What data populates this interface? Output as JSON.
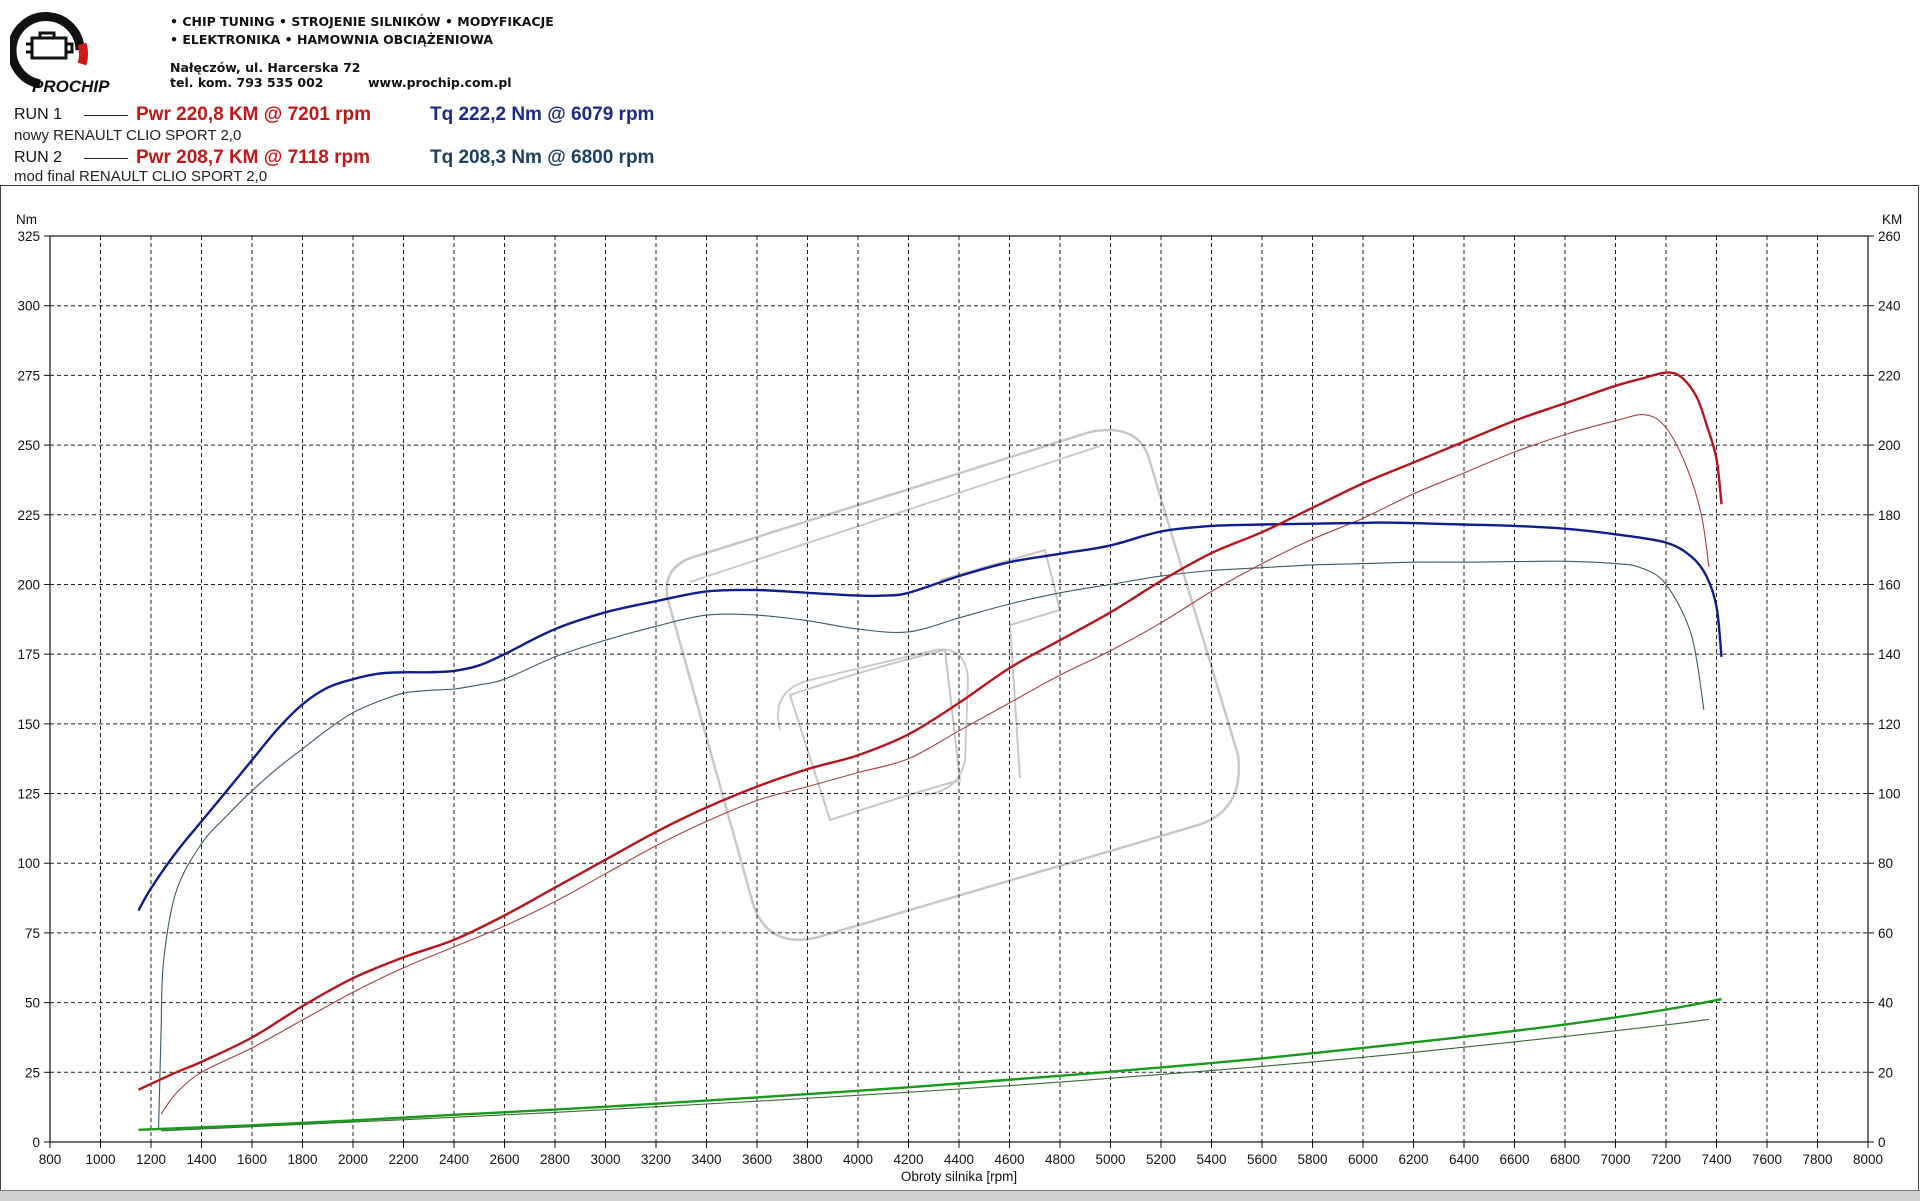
{
  "header": {
    "logo_text": "PROCHIP",
    "services_line1": "• CHIP TUNING • STROJENIE SILNIKÓW • MODYFIKACJE",
    "services_line2": "• ELEKTRONIKA • HAMOWNIA OBCIĄŻENIOWA",
    "address": "Nałęczów, ul. Harcerska 72",
    "phone": "tel. kom. 793 535 002",
    "website": "www.prochip.com.pl"
  },
  "runs": [
    {
      "label": "RUN 1",
      "power": "Pwr  220,8 KM @ 7201 rpm",
      "torque": "Tq 222,2 Nm @ 6079 rpm",
      "description": "nowy RENAULT CLIO SPORT 2,0"
    },
    {
      "label": "RUN 2",
      "power": "Pwr  208,7 KM @ 7118 rpm",
      "torque": "Tq 208,3 Nm @ 6800 rpm",
      "description": "mod final RENAULT CLIO SPORT 2,0"
    }
  ],
  "colors": {
    "power": "#b5161c",
    "power_run2": "#a84040",
    "torque": "#0e1e8c",
    "torque_run2": "#3a5a6a",
    "loss": "#1a9a1a",
    "loss_run2": "#3a6a3a",
    "grid": "#222222"
  },
  "chart_data": {
    "type": "line",
    "xlabel": "Obroty silnika [rpm]",
    "ylabel_left": "Nm",
    "ylabel_right": "KM",
    "xlim": [
      800,
      8000
    ],
    "ylim_left": [
      0,
      325
    ],
    "ylim_right": [
      0,
      260
    ],
    "x_ticks": [
      800,
      1000,
      1200,
      1400,
      1600,
      1800,
      2000,
      2200,
      2400,
      2600,
      2800,
      3000,
      3200,
      3400,
      3600,
      3800,
      4000,
      4200,
      4400,
      4600,
      4800,
      5000,
      5200,
      5400,
      5600,
      5800,
      6000,
      6200,
      6400,
      6600,
      6800,
      7000,
      7200,
      7400,
      7600,
      7800,
      8000
    ],
    "y_ticks_left": [
      0,
      25,
      50,
      75,
      100,
      125,
      150,
      175,
      200,
      225,
      250,
      275,
      300,
      325
    ],
    "y_ticks_right": [
      0,
      20,
      40,
      60,
      80,
      100,
      120,
      140,
      160,
      180,
      200,
      220,
      240,
      260
    ],
    "grid": true,
    "series": [
      {
        "name": "RUN 1 Tq",
        "axis": "left",
        "role": "torque",
        "run": 1,
        "x": [
          1150,
          1200,
          1300,
          1400,
          1500,
          1600,
          1700,
          1800,
          1900,
          2000,
          2100,
          2200,
          2300,
          2400,
          2500,
          2600,
          2800,
          3000,
          3200,
          3400,
          3600,
          3800,
          4000,
          4100,
          4200,
          4400,
          4600,
          4800,
          5000,
          5200,
          5400,
          5600,
          5800,
          6000,
          6079,
          6200,
          6400,
          6600,
          6800,
          7000,
          7200,
          7300,
          7360,
          7400,
          7420
        ],
        "y": [
          83,
          91,
          104,
          115,
          126,
          137,
          148,
          157,
          163,
          166,
          168,
          168.5,
          168.5,
          169,
          171,
          175,
          184,
          190,
          194,
          197.5,
          198,
          197,
          196,
          196,
          197,
          203,
          208,
          211,
          214,
          219,
          221,
          221.5,
          221.8,
          222.1,
          222.2,
          222,
          221.5,
          221,
          220,
          218,
          215,
          210,
          203,
          192,
          174
        ]
      },
      {
        "name": "RUN 2 Tq",
        "axis": "left",
        "role": "torque",
        "run": 2,
        "x": [
          1230,
          1240,
          1250,
          1300,
          1400,
          1500,
          1600,
          1700,
          1800,
          1900,
          2000,
          2100,
          2200,
          2300,
          2400,
          2500,
          2600,
          2800,
          3000,
          3200,
          3400,
          3600,
          3800,
          4000,
          4200,
          4400,
          4600,
          4800,
          5000,
          5200,
          5400,
          5600,
          5800,
          6000,
          6200,
          6400,
          6600,
          6800,
          7000,
          7100,
          7200,
          7300,
          7350
        ],
        "y": [
          5,
          40,
          65,
          90,
          107,
          117,
          126,
          134,
          141,
          148,
          154,
          158,
          161,
          162,
          162.5,
          164,
          166,
          174,
          180,
          185,
          189,
          189,
          187,
          184,
          183,
          188,
          193,
          197,
          200,
          203,
          205,
          206,
          207,
          207.5,
          208,
          208,
          208.2,
          208.3,
          207.5,
          206,
          200,
          182,
          155
        ]
      },
      {
        "name": "RUN 1 Pwr",
        "axis": "right",
        "role": "power",
        "run": 1,
        "x": [
          1150,
          1300,
          1400,
          1600,
          1800,
          2000,
          2200,
          2400,
          2600,
          2800,
          3000,
          3200,
          3400,
          3600,
          3800,
          4000,
          4200,
          4400,
          4600,
          4800,
          5000,
          5200,
          5400,
          5600,
          5800,
          6000,
          6200,
          6400,
          6600,
          6800,
          7000,
          7100,
          7201,
          7260,
          7320,
          7360,
          7400,
          7420
        ],
        "y": [
          15,
          20,
          23,
          30,
          39,
          47,
          53,
          58,
          65,
          73,
          81,
          89,
          96,
          102,
          107,
          111,
          117,
          126,
          136,
          144,
          152,
          161,
          169,
          175,
          182,
          189,
          195,
          201,
          207,
          212,
          217,
          219,
          220.8,
          219.5,
          214,
          206,
          196,
          183
        ]
      },
      {
        "name": "RUN 2 Pwr",
        "axis": "right",
        "role": "power",
        "run": 2,
        "x": [
          1240,
          1300,
          1400,
          1600,
          1800,
          2000,
          2200,
          2400,
          2600,
          2800,
          3000,
          3200,
          3400,
          3600,
          3800,
          4000,
          4200,
          4400,
          4600,
          4800,
          5000,
          5200,
          5400,
          5600,
          5800,
          6000,
          6200,
          6400,
          6600,
          6800,
          7000,
          7118,
          7200,
          7280,
          7340,
          7370
        ],
        "y": [
          8,
          14,
          20,
          27,
          35,
          43,
          50,
          56,
          62,
          69,
          77,
          85,
          92,
          98,
          102,
          106,
          110,
          118,
          126,
          134,
          141,
          149,
          158,
          166,
          173,
          179,
          186,
          192,
          198,
          203,
          207,
          208.7,
          205,
          194,
          180,
          165
        ]
      },
      {
        "name": "RUN 1 loss",
        "axis": "right",
        "role": "loss",
        "run": 1,
        "x": [
          1150,
          1600,
          2000,
          2400,
          2800,
          3200,
          3600,
          4000,
          4400,
          4800,
          5200,
          5600,
          6000,
          6400,
          6800,
          7200,
          7420
        ],
        "y": [
          3.5,
          4.8,
          6.2,
          7.8,
          9.3,
          11,
          12.8,
          14.7,
          16.8,
          19,
          21.4,
          24,
          27,
          30.2,
          33.7,
          38,
          41
        ]
      },
      {
        "name": "RUN 2 loss",
        "axis": "right",
        "role": "loss",
        "run": 2,
        "x": [
          1240,
          1600,
          2000,
          2400,
          2800,
          3200,
          3600,
          4000,
          4400,
          4800,
          5200,
          5600,
          6000,
          6400,
          6800,
          7200,
          7370
        ],
        "y": [
          3.2,
          4.4,
          5.7,
          7.1,
          8.5,
          10.1,
          11.7,
          13.4,
          15.2,
          17.2,
          19.4,
          21.7,
          24.3,
          27.2,
          30.3,
          33.6,
          35.2
        ]
      }
    ]
  }
}
